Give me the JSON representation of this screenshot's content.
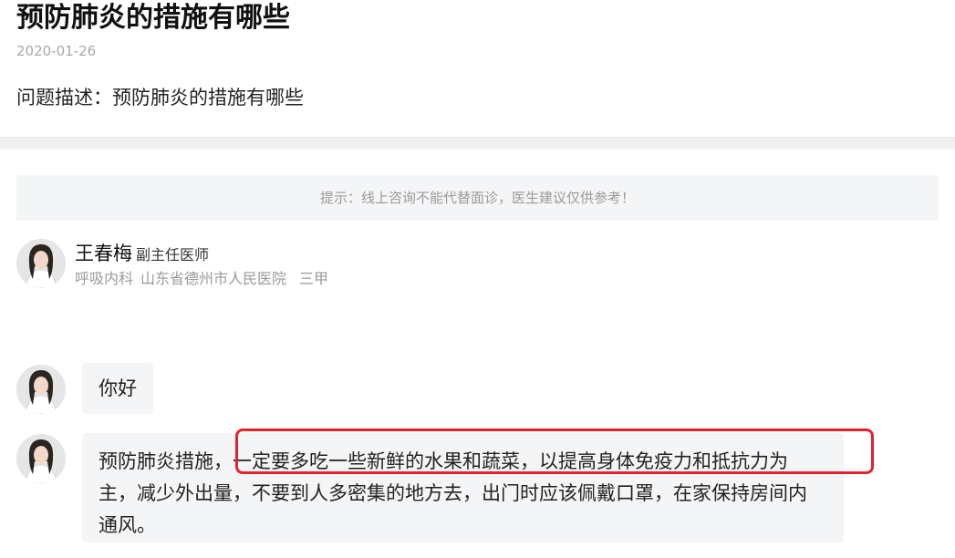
{
  "question": {
    "title": "预防肺炎的措施有哪些",
    "date": "2020-01-26",
    "description": "问题描述：预防肺炎的措施有哪些"
  },
  "notice": "提示：线上咨询不能代替面诊，医生建议仅供参考！",
  "doctor": {
    "name": "王春梅",
    "title": "副主任医师",
    "department": "呼吸内科",
    "hospital": "山东省德州市人民医院",
    "level": "三甲"
  },
  "messages": [
    {
      "text": "你好"
    },
    {
      "lines": [
        "预防肺炎措施，一定要多吃一些新鲜的水果和蔬菜，以提高身体免疫力和抵抗力为",
        "主，减少外出量，不要到人多密集的地方去，出门时应该佩戴口罩，在家保持房间内",
        "通风。"
      ]
    }
  ],
  "colors": {
    "highlight": "#e2232d",
    "bubble": "#f4f5f7",
    "muted": "#9a9a9a"
  }
}
